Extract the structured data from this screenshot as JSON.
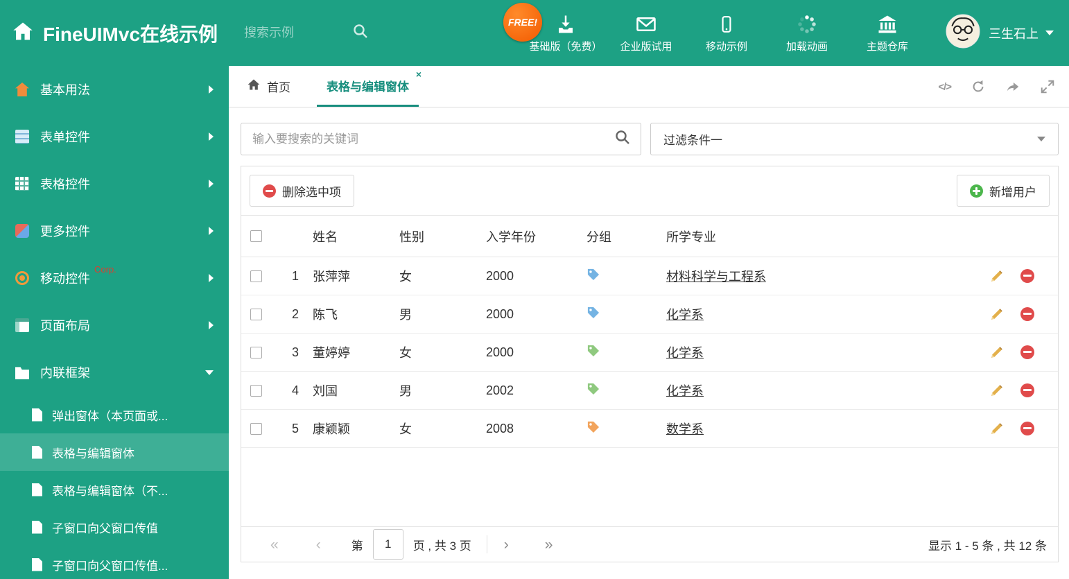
{
  "header": {
    "title": "FineUIMvc在线示例",
    "search_placeholder": "搜索示例",
    "free_badge": "FREE!",
    "nav_items": [
      {
        "label": "基础版（免费）",
        "icon": "download-icon"
      },
      {
        "label": "企业版试用",
        "icon": "envelope-icon"
      },
      {
        "label": "移动示例",
        "icon": "mobile-icon"
      },
      {
        "label": "加载动画",
        "icon": "spinner-icon"
      },
      {
        "label": "主题仓库",
        "icon": "bank-icon"
      }
    ],
    "user_name": "三生石上"
  },
  "sidebar": {
    "items": [
      {
        "label": "基本用法",
        "icon": "home-icon"
      },
      {
        "label": "表单控件",
        "icon": "form-icon"
      },
      {
        "label": "表格控件",
        "icon": "table-icon"
      },
      {
        "label": "更多控件",
        "icon": "widgets-icon"
      },
      {
        "label": "移动控件",
        "badge": "Corp.",
        "icon": "signal-icon"
      },
      {
        "label": "页面布局",
        "icon": "layout-icon"
      },
      {
        "label": "内联框架",
        "icon": "frame-icon",
        "expanded": true
      }
    ],
    "subitems": [
      {
        "label": "弹出窗体（本页面或..."
      },
      {
        "label": "表格与编辑窗体",
        "selected": true
      },
      {
        "label": "表格与编辑窗体（不..."
      },
      {
        "label": "子窗口向父窗口传值"
      },
      {
        "label": "子窗口向父窗口传值..."
      }
    ]
  },
  "tabs": {
    "home_label": "首页",
    "active_label": "表格与编辑窗体"
  },
  "filters": {
    "search_placeholder": "输入要搜索的关键词",
    "dropdown_value": "过滤条件一"
  },
  "toolbar": {
    "delete_label": "删除选中项",
    "add_label": "新增用户"
  },
  "table": {
    "headers": [
      "姓名",
      "性别",
      "入学年份",
      "分组",
      "所学专业"
    ],
    "rows": [
      {
        "num": "1",
        "name": "张萍萍",
        "gender": "女",
        "year": "2000",
        "tag_color": "#74b3e3",
        "major": "材料科学与工程系"
      },
      {
        "num": "2",
        "name": "陈飞",
        "gender": "男",
        "year": "2000",
        "tag_color": "#74b3e3",
        "major": "化学系"
      },
      {
        "num": "3",
        "name": "董婷婷",
        "gender": "女",
        "year": "2000",
        "tag_color": "#8fc97f",
        "major": "化学系"
      },
      {
        "num": "4",
        "name": "刘国",
        "gender": "男",
        "year": "2002",
        "tag_color": "#8fc97f",
        "major": "化学系"
      },
      {
        "num": "5",
        "name": "康颖颖",
        "gender": "女",
        "year": "2008",
        "tag_color": "#f2a45c",
        "major": "数学系"
      }
    ]
  },
  "pagination": {
    "prefix": "第",
    "current": "1",
    "suffix": "页 , 共 3 页",
    "summary": "显示 1 - 5 条 , 共 12 条"
  },
  "colors": {
    "accent": "#1DA184",
    "active_tab": "#178E7E",
    "danger": "#E04B4B",
    "success": "#4CB64C"
  }
}
